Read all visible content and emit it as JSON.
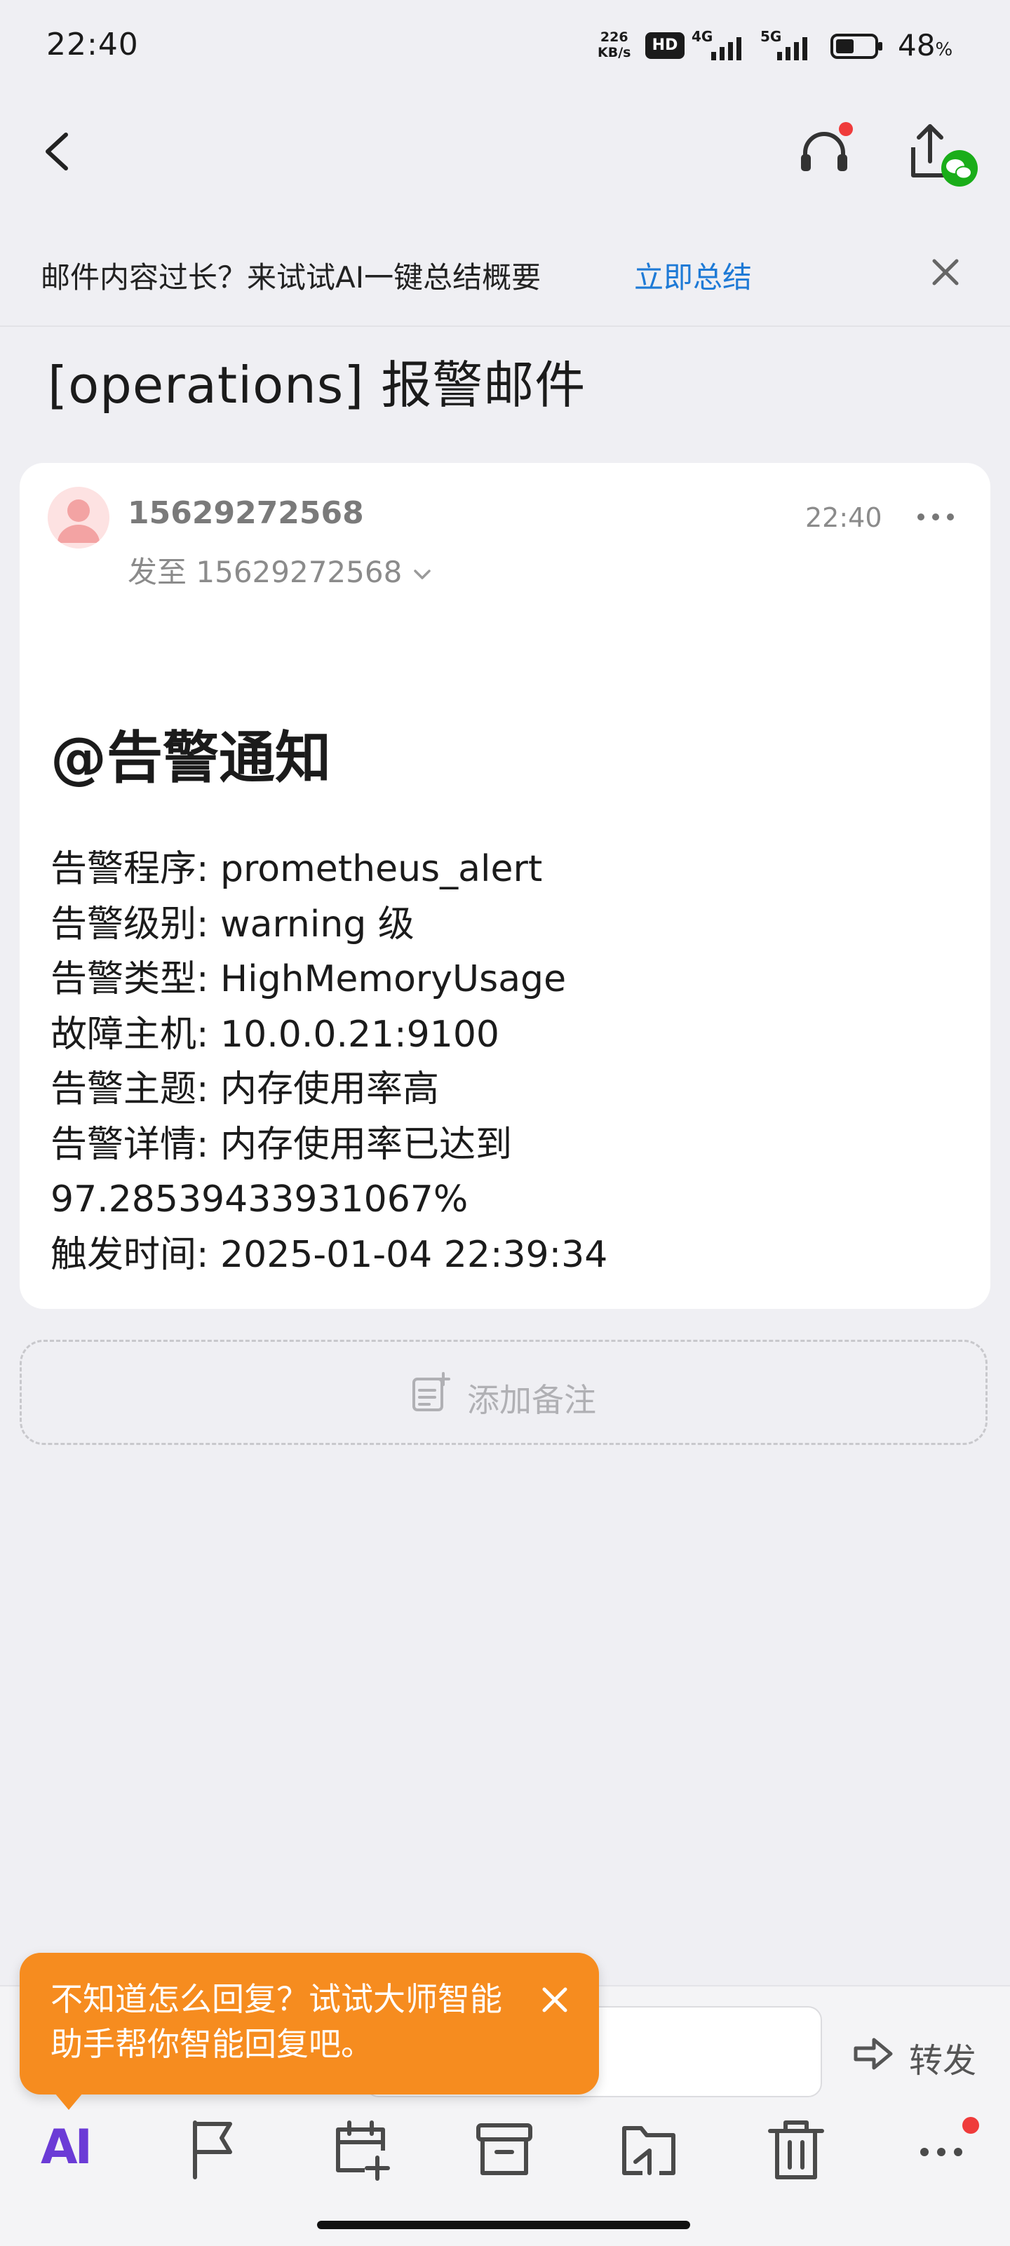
{
  "status_bar": {
    "time": "22:40",
    "net_speed_value": "226",
    "net_speed_unit": "KB/s",
    "hd_badge": "HD",
    "network_1": "4G",
    "network_2": "5G",
    "battery_percent": "48",
    "battery_symbol": "%",
    "battery_level": 0.48
  },
  "nav": {
    "back_icon": "chevron-left-icon",
    "headset_icon": "headset-icon",
    "share_icon": "share-wechat-icon"
  },
  "ai_banner": {
    "text": "邮件内容过长？来试试AI一键总结概要",
    "link": "立即总结"
  },
  "mail": {
    "subject": "[operations] 报警邮件",
    "sender": "15629272568",
    "recipient_prefix": "发至",
    "recipient": "15629272568",
    "time": "22:40",
    "heading": "@告警通知",
    "body_lines": [
      "告警程序: prometheus_alert",
      "告警级别: warning 级",
      "告警类型: HighMemoryUsage",
      "故障主机: 10.0.0.21:9100",
      "告警主题: 内存使用率高",
      "告警详情: 内存使用率已达到",
      "97.28539433931067%",
      "触发时间: 2025-01-04 22:39:34"
    ]
  },
  "add_note": {
    "label": "添加备注"
  },
  "tooltip": {
    "text": "不知道怎么回复？试试大师智能助手帮你智能回复吧。"
  },
  "reply": {
    "forward_label": "转发"
  },
  "toolbar": {
    "ai_label": "AI",
    "items": [
      "ai-icon",
      "flag-icon",
      "calendar-add-icon",
      "archive-icon",
      "move-folder-icon",
      "trash-icon",
      "more-icon"
    ]
  },
  "colors": {
    "accent_link": "#1e7ad6",
    "tooltip_orange": "#f68c1f",
    "ai_purple": "#6b3bd6",
    "notification_red": "#ef3b3b"
  }
}
